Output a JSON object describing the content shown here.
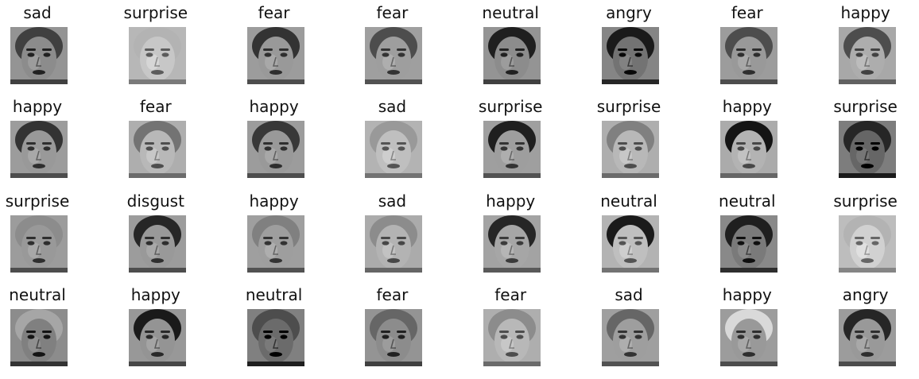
{
  "figure": {
    "rows": 4,
    "cols": 8,
    "panels": [
      {
        "label": "sad",
        "tone": 0.55,
        "hair": 0.25
      },
      {
        "label": "surprise",
        "tone": 0.78,
        "hair": 0.7
      },
      {
        "label": "fear",
        "tone": 0.6,
        "hair": 0.2
      },
      {
        "label": "fear",
        "tone": 0.62,
        "hair": 0.3
      },
      {
        "label": "neutral",
        "tone": 0.55,
        "hair": 0.12
      },
      {
        "label": "angry",
        "tone": 0.45,
        "hair": 0.1
      },
      {
        "label": "fear",
        "tone": 0.6,
        "hair": 0.3
      },
      {
        "label": "happy",
        "tone": 0.68,
        "hair": 0.3
      },
      {
        "label": "happy",
        "tone": 0.6,
        "hair": 0.2
      },
      {
        "label": "fear",
        "tone": 0.72,
        "hair": 0.45
      },
      {
        "label": "happy",
        "tone": 0.6,
        "hair": 0.22
      },
      {
        "label": "sad",
        "tone": 0.75,
        "hair": 0.6
      },
      {
        "label": "surprise",
        "tone": 0.62,
        "hair": 0.12
      },
      {
        "label": "surprise",
        "tone": 0.72,
        "hair": 0.5
      },
      {
        "label": "happy",
        "tone": 0.7,
        "hair": 0.08
      },
      {
        "label": "surprise",
        "tone": 0.4,
        "hair": 0.15
      },
      {
        "label": "surprise",
        "tone": 0.6,
        "hair": 0.55
      },
      {
        "label": "disgust",
        "tone": 0.6,
        "hair": 0.15
      },
      {
        "label": "happy",
        "tone": 0.62,
        "hair": 0.5
      },
      {
        "label": "sad",
        "tone": 0.7,
        "hair": 0.55
      },
      {
        "label": "happy",
        "tone": 0.65,
        "hair": 0.15
      },
      {
        "label": "neutral",
        "tone": 0.75,
        "hair": 0.1
      },
      {
        "label": "neutral",
        "tone": 0.48,
        "hair": 0.12
      },
      {
        "label": "surprise",
        "tone": 0.82,
        "hair": 0.7
      },
      {
        "label": "neutral",
        "tone": 0.5,
        "hair": 0.65
      },
      {
        "label": "happy",
        "tone": 0.58,
        "hair": 0.1
      },
      {
        "label": "neutral",
        "tone": 0.42,
        "hair": 0.3
      },
      {
        "label": "fear",
        "tone": 0.55,
        "hair": 0.4
      },
      {
        "label": "fear",
        "tone": 0.72,
        "hair": 0.55
      },
      {
        "label": "sad",
        "tone": 0.62,
        "hair": 0.4
      },
      {
        "label": "happy",
        "tone": 0.6,
        "hair": 0.85
      },
      {
        "label": "angry",
        "tone": 0.6,
        "hair": 0.15
      }
    ]
  }
}
